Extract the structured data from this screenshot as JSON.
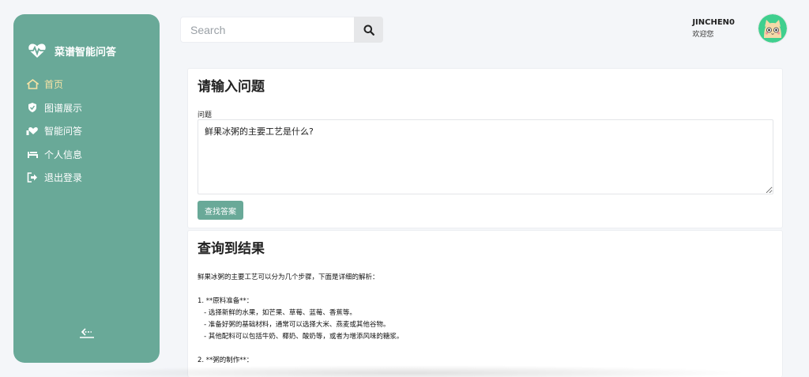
{
  "sidebar": {
    "brand": "菜谱智能问答",
    "items": [
      {
        "label": "首页",
        "icon": "home-icon",
        "active": true
      },
      {
        "label": "图谱展示",
        "icon": "shield-icon",
        "active": false
      },
      {
        "label": "智能问答",
        "icon": "heart-hand-icon",
        "active": false
      },
      {
        "label": "个人信息",
        "icon": "bed-icon",
        "active": false
      },
      {
        "label": "退出登录",
        "icon": "logout-icon",
        "active": false
      }
    ],
    "collapse_icon": "collapse-arrow-icon"
  },
  "search": {
    "placeholder": "Search",
    "value": ""
  },
  "user": {
    "name": "JINCHEN0",
    "greeting": "欢迎您"
  },
  "question_card": {
    "title": "请输入问题",
    "field_label": "问题",
    "question": "鲜果冰粥的主要工艺是什么?",
    "button": "查找答案"
  },
  "result_card": {
    "title": "查询到结果",
    "lines": [
      "鲜果冰粥的主要工艺可以分为几个步骤，下面是详细的解析：",
      "",
      "1. **原料准备**：",
      "   - 选择新鲜的水果，如芒果、草莓、蓝莓、香蕉等。",
      "   - 准备好粥的基础材料，通常可以选择大米、燕麦或其他谷物。",
      "   - 其他配料可以包括牛奶、椰奶、酸奶等，或者为增添风味的糖浆。",
      "",
      "2. **粥的制作**："
    ]
  },
  "colors": {
    "accent": "#69a998",
    "active_nav": "#f7e3a6",
    "background": "#f4f6f9"
  }
}
